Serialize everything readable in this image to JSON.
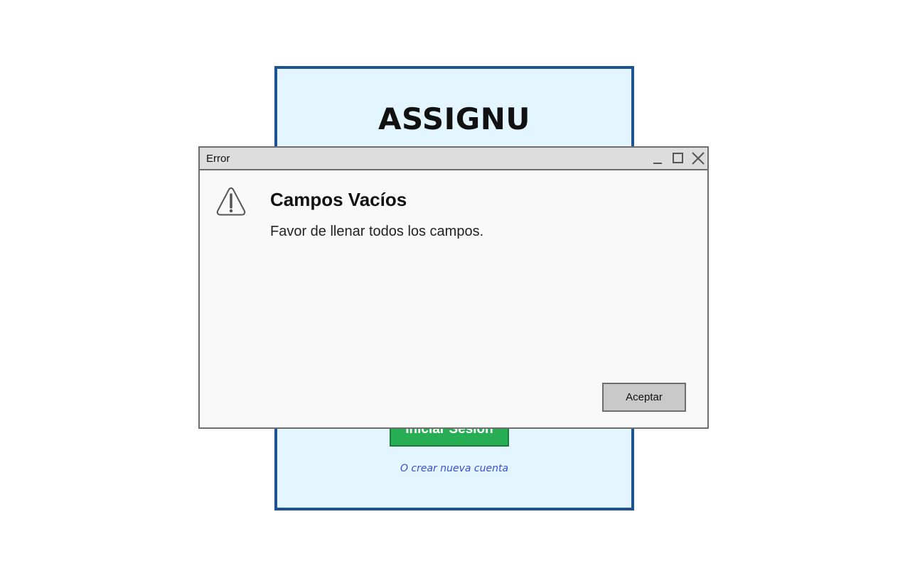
{
  "login": {
    "app_title": "ASSIGNU",
    "login_button_label": "Iniciar Sesión",
    "create_account_link": "O crear nueva cuenta"
  },
  "dialog": {
    "window_title": "Error",
    "heading": "Campos Vacíos",
    "message": "Favor de llenar todos los campos.",
    "accept_label": "Aceptar",
    "controls": [
      "minimize-icon",
      "maximize-icon",
      "close-icon"
    ],
    "icon": "warning-icon"
  },
  "colors": {
    "card_border": "#1d5293",
    "card_background": "#e3f5fe",
    "login_button": "#27ae55",
    "link": "#3b4fd1",
    "dialog_background": "#f9f9f9",
    "titlebar": "#dddddd"
  }
}
